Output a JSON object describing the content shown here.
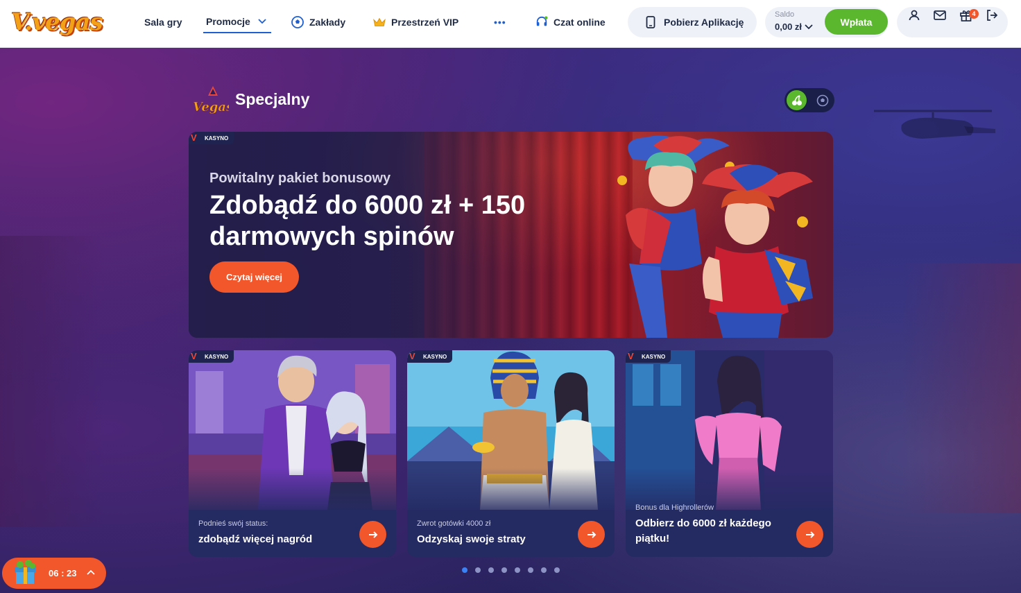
{
  "header": {
    "logo_text": "V.vegas",
    "nav": [
      {
        "label": "Sala gry"
      },
      {
        "label": "Promocje"
      },
      {
        "label": "Zakłady"
      },
      {
        "label": "Przestrzeń VIP"
      },
      {
        "label": "Czat online"
      }
    ],
    "more_label": "•••",
    "app_button": "Pobierz Aplikację",
    "balance_label": "Saldo",
    "balance_value": "0,00 zł",
    "deposit_button": "Wpłata",
    "gift_badge": "4"
  },
  "section": {
    "title": "Specjalny",
    "logo_text": "Vegas"
  },
  "hero": {
    "tag": "KASYNO",
    "subtitle": "Powitalny pakiet bonusowy",
    "title": "Zdobądź do 6000 zł + 150 darmowych spinów",
    "button": "Czytaj więcej"
  },
  "cards": [
    {
      "tag": "KASYNO",
      "subtitle": "Podnieś swój status:",
      "title": "zdobądź więcej nagród"
    },
    {
      "tag": "KASYNO",
      "subtitle": "Zwrot gotówki 4000 zł",
      "title": "Odzyskaj swoje straty"
    },
    {
      "tag": "KASYNO",
      "subtitle": "Bonus dla Highrollerów",
      "title": "Odbierz do 6000 zł każdego piątku!"
    }
  ],
  "pagination": {
    "count": 8,
    "active": 1
  },
  "timer": {
    "value": "06 : 23"
  },
  "colors": {
    "accent": "#f2562b",
    "green": "#5bb82e",
    "blue": "#1e5fd1"
  }
}
